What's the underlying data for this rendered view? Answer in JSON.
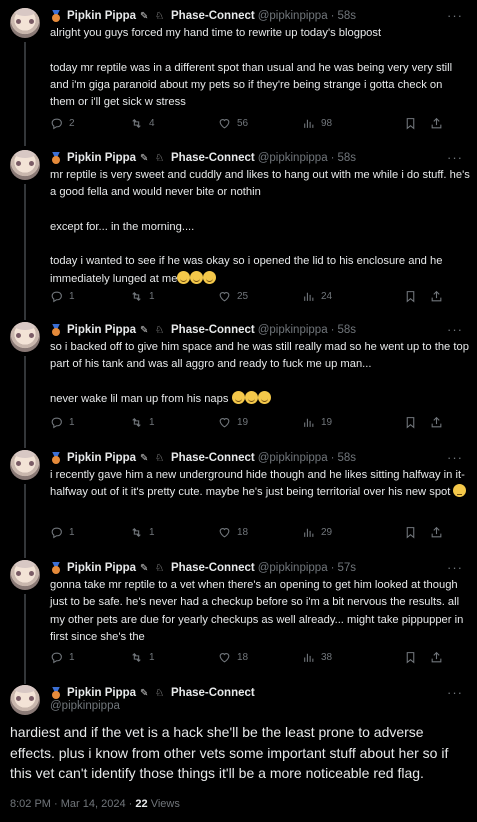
{
  "author": {
    "name": "Pipkin Pippa",
    "affiliation": "Phase-Connect",
    "handle": "@pipkinpippa",
    "badge_icon": "medal-icon",
    "name_emojis": [
      "knife-icon",
      "rabbit-icon"
    ]
  },
  "tweets": [
    {
      "time": "58s",
      "text": "alright you guys forced my hand time to rewrite up today's blogpost\n\ntoday mr reptile was in a different spot than usual and he was being very very still and i'm giga paranoid about my pets so if they're being strange i gotta check on them or i'll get sick w stress",
      "replies": "2",
      "reposts": "4",
      "likes": "56",
      "views": "98"
    },
    {
      "time": "58s",
      "text": "mr reptile is very sweet and cuddly and likes to hang out with me while i do stuff. he's a good fella and would never bite or nothin\n\nexcept for... in the morning....\n\ntoday i wanted to see if he was okay so i opened the lid to his enclosure and he immediately lunged at me",
      "emojis": [
        "face-with-open-eyes-and-hand-over-mouth",
        "face-with-open-eyes-and-hand-over-mouth",
        "face-with-open-eyes-and-hand-over-mouth"
      ],
      "replies": "1",
      "reposts": "1",
      "likes": "25",
      "views": "24"
    },
    {
      "time": "58s",
      "text": "so i backed off to give him space and he was still really mad so he went up to the top part of his tank and was all aggro and ready to fuck me up man...\n\nnever wake lil man up from his naps ",
      "emojis": [
        "face-with-open-eyes-and-hand-over-mouth",
        "face-with-open-eyes-and-hand-over-mouth",
        "face-with-open-eyes-and-hand-over-mouth"
      ],
      "replies": "1",
      "reposts": "1",
      "likes": "19",
      "views": "19"
    },
    {
      "time": "58s",
      "text": "i recently gave him a new underground hide though and he likes sitting halfway in it-halfway out of it it's pretty cute. maybe he's just being territorial over his new spot ",
      "emojis": [
        "thinking-face"
      ],
      "replies": "1",
      "reposts": "1",
      "likes": "18",
      "views": "29"
    },
    {
      "time": "57s",
      "text": "gonna take mr reptile to a vet when there's an opening to get him looked at though just to be safe. he's never had a checkup before so i'm a bit nervous the results. all my other pets are due for yearly checkups as well already... might take pippupper in first since she's the",
      "replies": "1",
      "reposts": "1",
      "likes": "18",
      "views": "38"
    }
  ],
  "main_tweet": {
    "text": "hardiest and if the vet is a hack she'll be the least prone to adverse effects. plus i know from other vets some important stuff about her so if this vet can't identify those things it'll be a more noticeable red flag.",
    "time": "8:02 PM",
    "date": "Mar 14, 2024",
    "views_count": "22",
    "views_label": "Views"
  }
}
